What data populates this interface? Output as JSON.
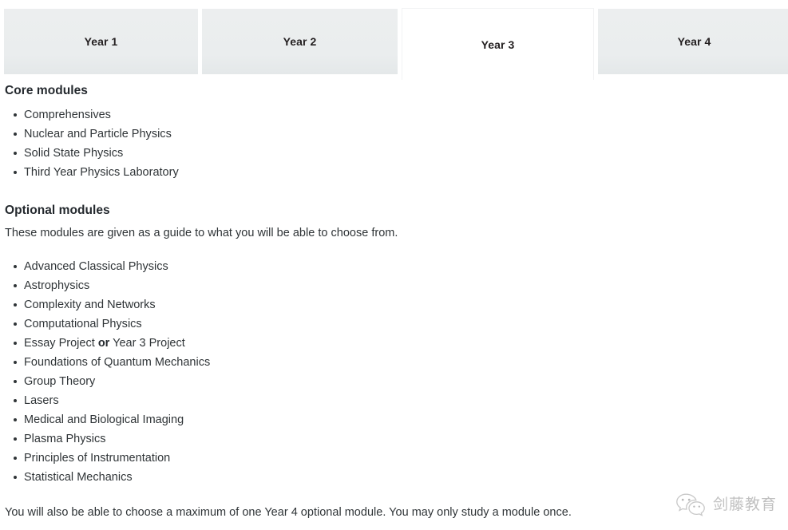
{
  "tabs": [
    {
      "label": "Year 1",
      "active": false
    },
    {
      "label": "Year 2",
      "active": false
    },
    {
      "label": "Year 3",
      "active": true
    },
    {
      "label": "Year 4",
      "active": false
    }
  ],
  "core": {
    "heading": "Core modules",
    "items": [
      "Comprehensives",
      "Nuclear and Particle Physics",
      "Solid State Physics",
      "Third Year Physics Laboratory"
    ]
  },
  "optional": {
    "heading": "Optional modules",
    "intro": "These modules are given as a guide to what you will be able to choose from.",
    "items": [
      {
        "text": "Advanced Classical Physics"
      },
      {
        "text": "Astrophysics"
      },
      {
        "text": "Complexity and Networks"
      },
      {
        "text": "Computational Physics"
      },
      {
        "pre": "Essay Project ",
        "bold": "or",
        "post": " Year 3 Project"
      },
      {
        "text": "Foundations of Quantum Mechanics"
      },
      {
        "text": "Group Theory"
      },
      {
        "text": "Lasers"
      },
      {
        "text": "Medical and Biological Imaging"
      },
      {
        "text": "Plasma Physics"
      },
      {
        "text": "Principles of Instrumentation"
      },
      {
        "text": "Statistical Mechanics"
      }
    ]
  },
  "footnote": "You will also be able to choose a maximum of one Year 4 optional module. You may only study a module once.",
  "watermark": {
    "icon": "wechat-icon",
    "text": "剑藤教育"
  },
  "colors": {
    "tab_inactive_bg": "#eaedee",
    "tab_active_bg": "#ffffff",
    "text": "#2f3437",
    "heading": "#24292e",
    "watermark": "#9b9b9b"
  }
}
